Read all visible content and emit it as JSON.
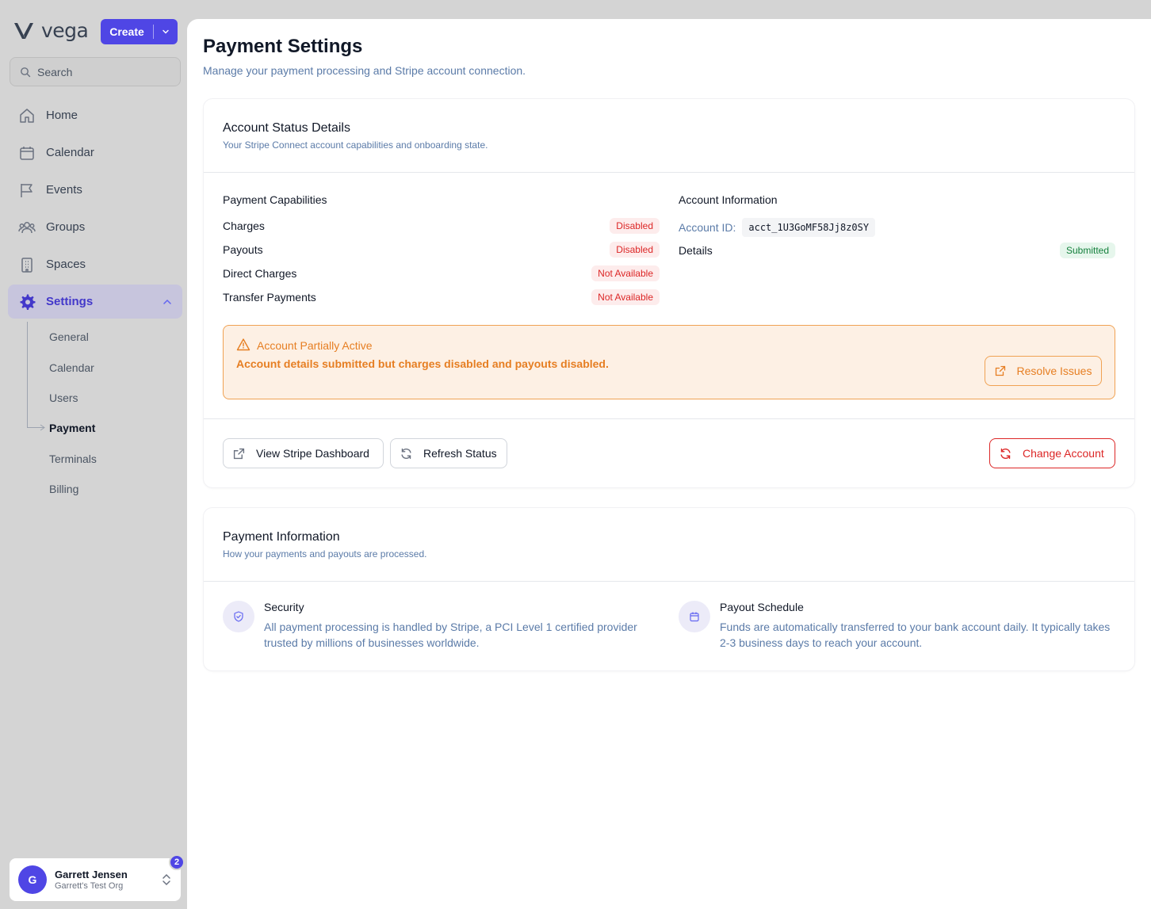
{
  "brand": {
    "name": "vega"
  },
  "create_button": {
    "label": "Create"
  },
  "search": {
    "placeholder": "Search"
  },
  "nav": {
    "items": [
      {
        "label": "Home",
        "icon": "home-icon"
      },
      {
        "label": "Calendar",
        "icon": "calendar-icon"
      },
      {
        "label": "Events",
        "icon": "flag-icon"
      },
      {
        "label": "Groups",
        "icon": "users-icon"
      },
      {
        "label": "Spaces",
        "icon": "building-icon"
      },
      {
        "label": "Settings",
        "icon": "gear-icon",
        "active": true
      }
    ],
    "settings_sub": [
      "General",
      "Calendar",
      "Users",
      "Payment",
      "Terminals",
      "Billing"
    ],
    "active_sub": "Payment"
  },
  "user": {
    "initial": "G",
    "name": "Garrett Jensen",
    "org": "Garrett's Test Org",
    "notification_count": "2"
  },
  "page": {
    "title": "Payment Settings",
    "subtitle": "Manage your payment processing and Stripe account connection."
  },
  "status_card": {
    "title": "Account Status Details",
    "subtitle": "Your Stripe Connect account capabilities and onboarding state.",
    "capabilities_heading": "Payment Capabilities",
    "capabilities": [
      {
        "label": "Charges",
        "status": "Disabled"
      },
      {
        "label": "Payouts",
        "status": "Disabled"
      },
      {
        "label": "Direct Charges",
        "status": "Not Available"
      },
      {
        "label": "Transfer Payments",
        "status": "Not Available"
      }
    ],
    "account_heading": "Account Information",
    "account_id_label": "Account ID:",
    "account_id": "acct_1U3GoMF58Jj8z0SY",
    "details_label": "Details",
    "details_status": "Submitted",
    "alert": {
      "title": "Account Partially Active",
      "message": "Account details submitted but charges disabled and payouts disabled.",
      "action": "Resolve Issues"
    },
    "actions": {
      "dashboard": "View Stripe Dashboard",
      "refresh": "Refresh Status",
      "change": "Change Account"
    }
  },
  "info_card": {
    "title": "Payment Information",
    "subtitle": "How your payments and payouts are processed.",
    "security_title": "Security",
    "security_text": "All payment processing is handled by Stripe, a PCI Level 1 certified provider trusted by millions of businesses worldwide.",
    "payout_title": "Payout Schedule",
    "payout_text": "Funds are automatically transferred to your bank account daily. It typically takes 2-3 business days to reach your account."
  },
  "colors": {
    "accent": "#4f46e5",
    "warning": "#e67e22",
    "danger": "#dc2626",
    "success": "#15803d"
  }
}
